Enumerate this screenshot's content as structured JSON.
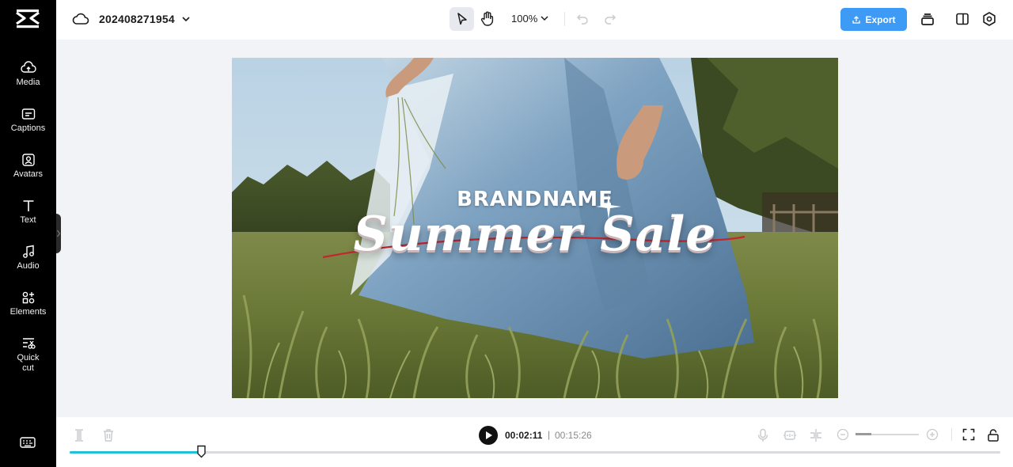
{
  "app": {
    "project_name": "202408271954"
  },
  "sidebar": {
    "items": [
      {
        "label": "Media",
        "icon": "cloud-upload-icon"
      },
      {
        "label": "Captions",
        "icon": "captions-icon"
      },
      {
        "label": "Avatars",
        "icon": "avatar-icon"
      },
      {
        "label": "Text",
        "icon": "text-icon"
      },
      {
        "label": "Audio",
        "icon": "music-note-icon"
      },
      {
        "label": "Elements",
        "icon": "elements-icon"
      },
      {
        "label": "Quick\ncut",
        "icon": "quick-cut-icon"
      }
    ]
  },
  "toolbar": {
    "zoom": "100%",
    "export_label": "Export",
    "accent_color": "#3e9bf5"
  },
  "canvas": {
    "brand": "BRANDNAME",
    "title": "Summer Sale"
  },
  "playback": {
    "current_time": "00:02:11",
    "separator": "|",
    "total_time": "00:15:26",
    "progress_fraction": 0.1415,
    "progress_color": "#22c1d9"
  }
}
